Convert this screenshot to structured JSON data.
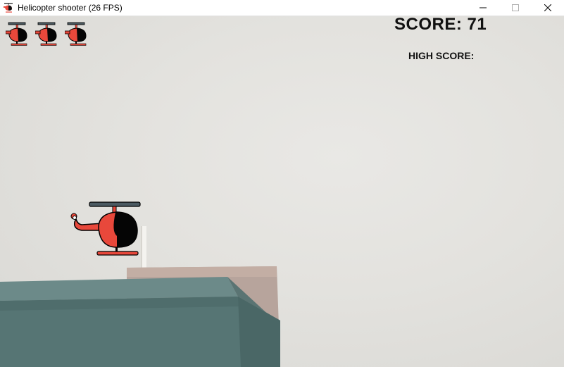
{
  "window": {
    "title": "Helicopter shooter (26 FPS)",
    "icon": "helicopter-app-icon",
    "controls": [
      "minimize-icon",
      "maximize-icon",
      "close-icon"
    ]
  },
  "hud": {
    "score_text": "SCORE: 71",
    "high_score_text": "HIGH SCORE:",
    "lives": 3,
    "life_icon": "helicopter-life-icon"
  },
  "colors": {
    "helicopter_body": "#e8483b",
    "helicopter_cockpit": "#050505",
    "rotor": "#4b5a62",
    "building": "#577676",
    "roof": "#b8a39a",
    "sky": "#e4e3df"
  }
}
